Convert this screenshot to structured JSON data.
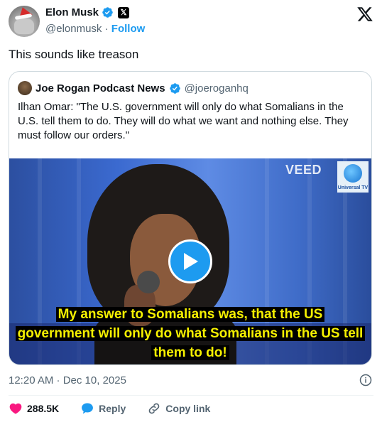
{
  "author": {
    "name": "Elon Musk",
    "handle": "@elonmusk",
    "separator": "·",
    "follow_label": "Follow",
    "avatar_icon": "avatar-santa-hat"
  },
  "tweet": {
    "text": "This sounds like treason",
    "timestamp": "12:20 AM · Dec 10, 2025"
  },
  "quoted": {
    "name": "Joe Rogan Podcast News",
    "handle": "@joeroganhq",
    "text": "Ilhan Omar: \"The U.S. government will only do what Somalians in the U.S. tell them to do. They will do what we want and nothing else. They must follow our orders.\"",
    "video": {
      "watermark": "VEED",
      "logo_text": "Universal TV",
      "caption_lines": [
        "My answer to Somalians was,  that the US",
        "government will only do what Somalians in the US tell",
        "them to do!"
      ]
    }
  },
  "actions": {
    "likes": "288.5K",
    "reply_label": "Reply",
    "copy_link_label": "Copy link"
  },
  "colors": {
    "accent": "#1d9bf0",
    "like": "#f91880",
    "caption_text": "#f5f000",
    "muted": "#536471"
  }
}
